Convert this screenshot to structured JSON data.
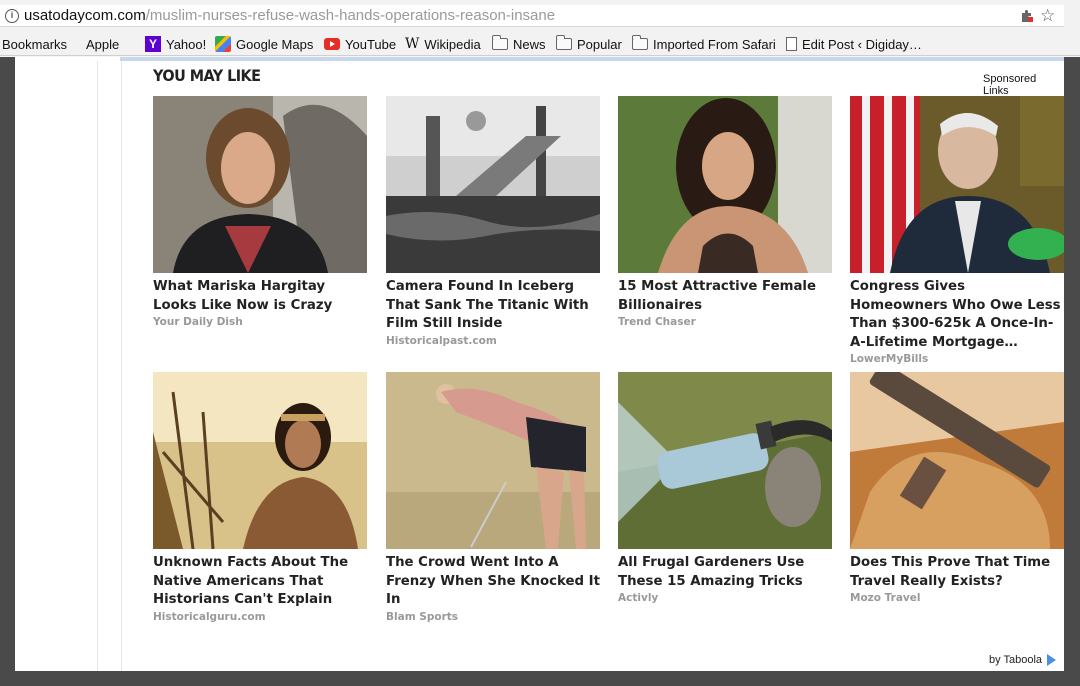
{
  "browser": {
    "url_host": "usatodaycom.com",
    "url_path": "/muslim-nurses-refuse-wash-hands-operations-reason-insane"
  },
  "bookmarks": [
    {
      "label": "Bookmarks",
      "icon": ""
    },
    {
      "label": "Apple",
      "icon": "apple-icon"
    },
    {
      "label": "Yahoo!",
      "icon": "yahoo-icon"
    },
    {
      "label": "Google Maps",
      "icon": "google-maps-icon"
    },
    {
      "label": "YouTube",
      "icon": "youtube-icon"
    },
    {
      "label": "Wikipedia",
      "icon": "wikipedia-icon"
    },
    {
      "label": "News",
      "icon": "folder-icon"
    },
    {
      "label": "Popular",
      "icon": "folder-icon"
    },
    {
      "label": "Imported From Safari",
      "icon": "folder-icon"
    },
    {
      "label": "Edit Post ‹ Digiday…",
      "icon": "page-icon"
    }
  ],
  "widget": {
    "title": "YOU MAY LIKE",
    "sponsored": "Sponsored Links",
    "by_taboola": "by Taboola",
    "cards": [
      {
        "title": "What Mariska Hargitay Looks Like Now is Crazy",
        "source": "Your Daily Dish",
        "image": "woman-portrait"
      },
      {
        "title": "Camera Found In Iceberg That Sank The Titanic With Film Still Inside",
        "source": "Historicalpast.com",
        "image": "flooded-staircase"
      },
      {
        "title": "15 Most Attractive Female Billionaires",
        "source": "Trend Chaser",
        "image": "woman-portrait"
      },
      {
        "title": "Congress Gives Homeowners Who Owe Less Than $300-625k A Once-In-A-Lifetime Mortgage…",
        "source": "LowerMyBills",
        "image": "man-at-desk"
      },
      {
        "title": "Unknown Facts About The Native Americans That Historians Can't Explain",
        "source": "Historicalguru.com",
        "image": "woman-in-field"
      },
      {
        "title": "The Crowd Went Into A Frenzy When She Knocked It In",
        "source": "Blam Sports",
        "image": "golfer"
      },
      {
        "title": "All Frugal Gardeners Use These 15 Amazing Tricks",
        "source": "Activly",
        "image": "bottle-sprinkler"
      },
      {
        "title": "Does This Prove That Time Travel Really Exists?",
        "source": "Mozo Travel",
        "image": "hammer-in-rock"
      }
    ]
  }
}
